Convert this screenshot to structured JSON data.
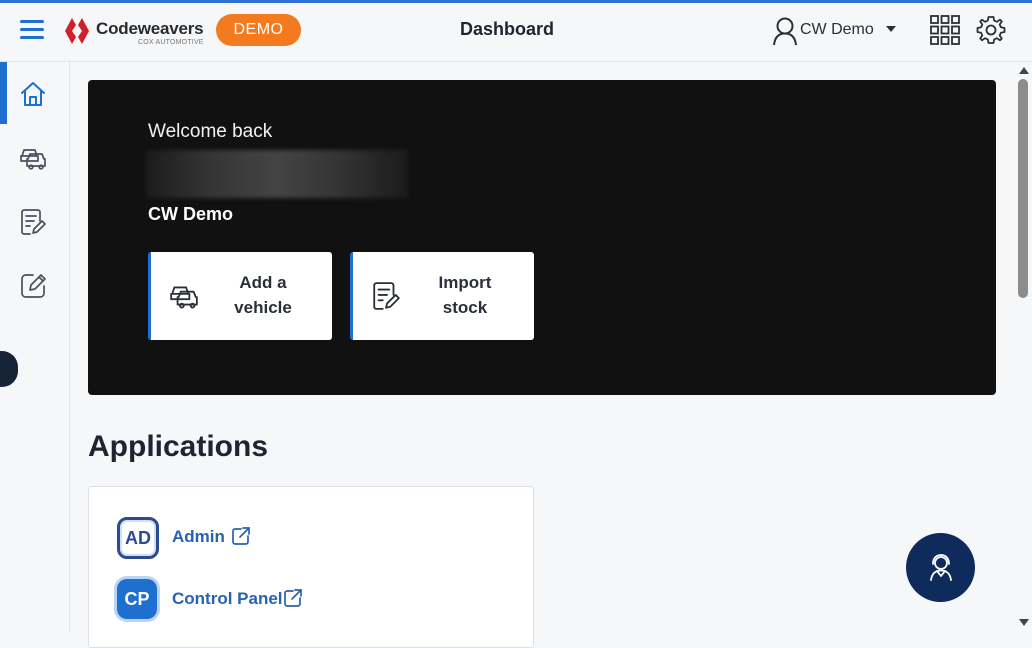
{
  "header": {
    "logo_text": "Codeweavers",
    "logo_subtext": "COX AUTOMOTIVE",
    "demo_label": "DEMO",
    "page_title": "Dashboard",
    "user_name": "CW Demo"
  },
  "sidebar": {
    "items": [
      {
        "icon": "home-icon",
        "active": true
      },
      {
        "icon": "cars-icon",
        "active": false
      },
      {
        "icon": "notes-edit-icon",
        "active": false
      },
      {
        "icon": "edit-square-icon",
        "active": false
      }
    ]
  },
  "hero": {
    "welcome_text": "Welcome back",
    "user_name": "CW Demo",
    "actions": [
      {
        "label": "Add a vehicle",
        "icon": "cars-icon"
      },
      {
        "label": "Import stock",
        "icon": "notes-edit-icon"
      }
    ]
  },
  "applications": {
    "heading": "Applications",
    "items": [
      {
        "badge": "AD",
        "name": "Admin"
      },
      {
        "badge": "CP",
        "name": "Control Panel"
      }
    ]
  },
  "colors": {
    "accent": "#1f6fd1",
    "demo_badge": "#f47a20",
    "hero_background": "#111111",
    "fab_background": "#0f2b5c"
  }
}
